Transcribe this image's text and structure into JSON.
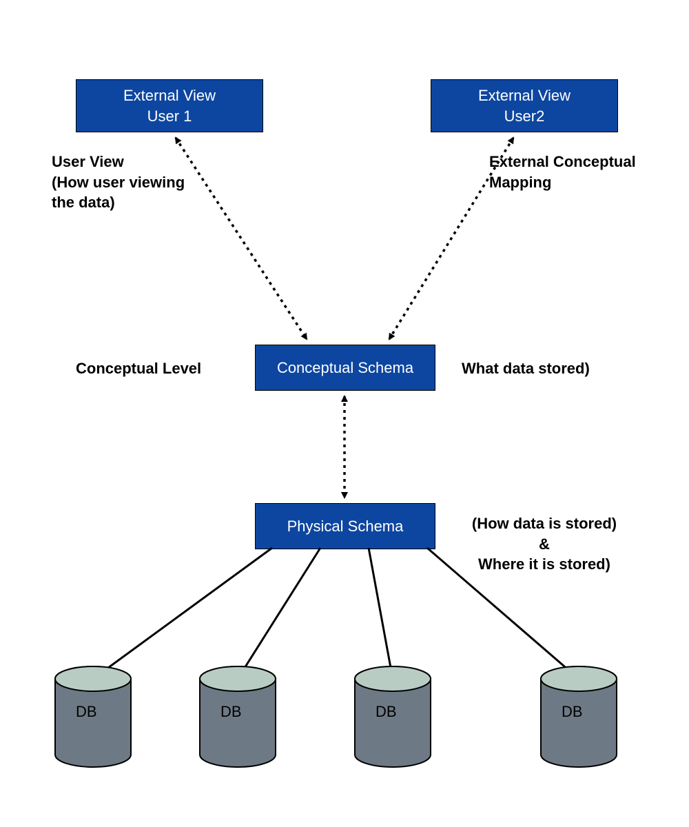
{
  "boxes": {
    "external_view_1": {
      "line1": "External View",
      "line2": "User 1"
    },
    "external_view_2": {
      "line1": "External View",
      "line2": "User2"
    },
    "conceptual_schema": "Conceptual Schema",
    "physical_schema": "Physical Schema"
  },
  "labels": {
    "user_view_l1": "User View",
    "user_view_l2": "(How user viewing",
    "user_view_l3": "the data)",
    "ext_concept_map_l1": "External Conceptual",
    "ext_concept_map_l2": "Mapping",
    "conceptual_level": "Conceptual Level",
    "what_data_stored": "What data stored)",
    "how_stored_l1": "(How data is stored)",
    "how_stored_l2": "&",
    "how_stored_l3": "Where it is stored)"
  },
  "db": {
    "label": "DB"
  },
  "colors": {
    "box_fill": "#0d46a0",
    "db_top": "#b9ccc4",
    "db_side": "#6d7a85"
  }
}
